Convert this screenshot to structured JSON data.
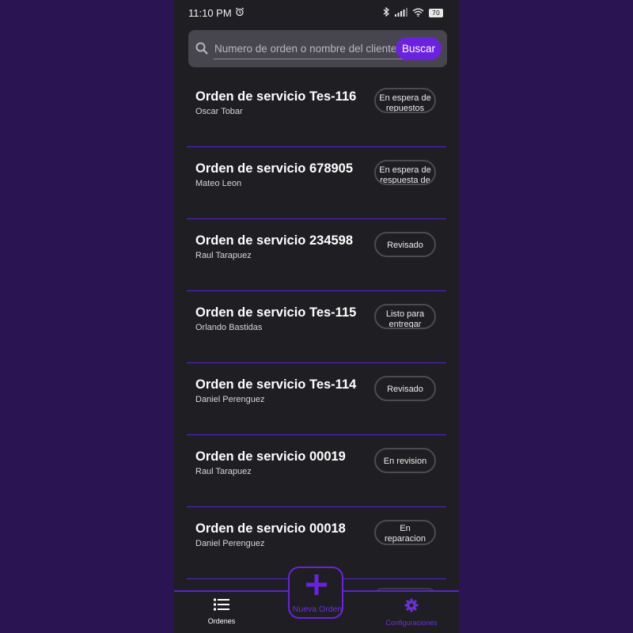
{
  "status_bar": {
    "time": "11:10 PM",
    "battery": "70"
  },
  "search": {
    "placeholder": "Numero de orden o nombre del cliente",
    "button_label": "Buscar"
  },
  "orders": [
    {
      "title": "Orden de servicio Tes-116",
      "client": "Oscar Tobar",
      "status": "En espera de repuestos"
    },
    {
      "title": "Orden de servicio 678905",
      "client": "Mateo Leon",
      "status": "En espera de respuesta de"
    },
    {
      "title": "Orden de servicio 234598",
      "client": "Raul Tarapuez",
      "status": "Revisado"
    },
    {
      "title": "Orden de servicio Tes-115",
      "client": "Orlando Bastidas",
      "status": "Listo para entregar"
    },
    {
      "title": "Orden de servicio Tes-114",
      "client": "Daniel Perenguez",
      "status": "Revisado"
    },
    {
      "title": "Orden de servicio 00019",
      "client": "Raul Tarapuez",
      "status": "En revision"
    },
    {
      "title": "Orden de servicio 00018",
      "client": "Daniel Perenguez",
      "status": "En reparacion"
    }
  ],
  "bottom_nav": {
    "orders_label": "Ordenes",
    "new_order_label": "Nueva Orden",
    "settings_label": "Configuraciones"
  },
  "colors": {
    "accent": "#6b22e0",
    "background": "#1f1f23",
    "outer_background": "#2a1452",
    "divider": "#5a22d8"
  },
  "icons": {
    "alarm": "alarm-icon",
    "bluetooth": "bluetooth-icon",
    "signal": "signal-icon",
    "wifi": "wifi-icon",
    "battery": "battery-icon",
    "search": "search-icon",
    "orders": "list-icon",
    "new_order": "plus-icon",
    "settings": "gear-icon"
  }
}
